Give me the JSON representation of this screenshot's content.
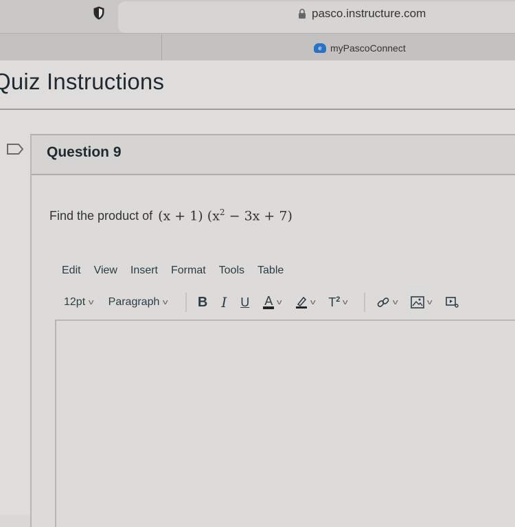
{
  "browser": {
    "url": "pasco.instructure.com",
    "bookmark": {
      "label": "myPascoConnect",
      "icon": "cloud-icon"
    },
    "icons": {
      "shield": "shield-icon",
      "lock": "lock-icon"
    }
  },
  "page": {
    "title": "Quiz Instructions"
  },
  "question": {
    "title": "Question 9",
    "flag_icon": "bookmark-flag-icon",
    "prompt": "Find the product of",
    "expression": {
      "factor1": "(x + 1)",
      "factor2_open": "(x",
      "factor2_exp": "2",
      "factor2_rest": "− 3x + 7)"
    }
  },
  "editor": {
    "menu": [
      "Edit",
      "View",
      "Insert",
      "Format",
      "Tools",
      "Table"
    ],
    "font_size": "12pt",
    "block_format": "Paragraph",
    "toolbar": {
      "bold": "B",
      "italic": "I",
      "underline": "U",
      "text_color": "A",
      "superscript": "T",
      "superscript_exp": "2"
    },
    "content": ""
  }
}
